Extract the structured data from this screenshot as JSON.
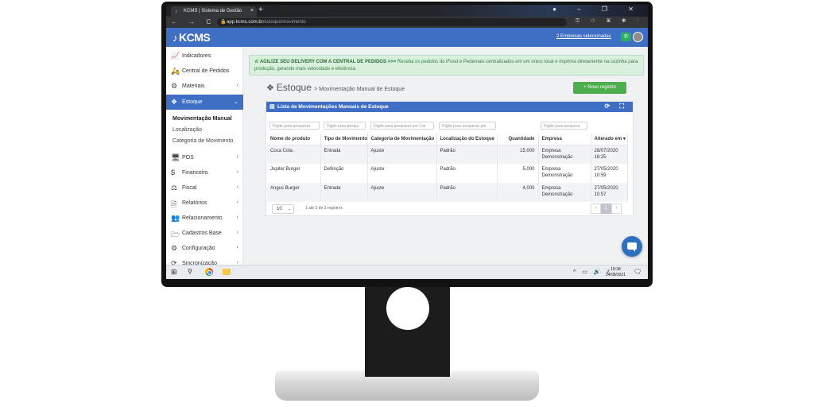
{
  "browser": {
    "tab_title": "KCMS | Sistema de Gestão",
    "tab_close": "×",
    "new_tab": "+",
    "window_controls": "● – ❐ ✕",
    "nav_icons": "← → C ⌂",
    "url_host": "app.kcms.com.br",
    "url_path": "/estoque/movimento",
    "extension_icons": "⚿ ☆ ▣ ✱ ⋮"
  },
  "header": {
    "logo": "KCMS",
    "companies_link": "2 Empresas selecionadas"
  },
  "sidebar": {
    "items": [
      {
        "label": "Indicadores",
        "icon": "chart-line-icon",
        "glyph": "📈",
        "chevron": ""
      },
      {
        "label": "Central de Pedidos",
        "icon": "motorcycle-icon",
        "glyph": "🛵",
        "chevron": ""
      },
      {
        "label": "Materiais",
        "icon": "cubes-icon",
        "glyph": "⚙",
        "chevron": "‹"
      },
      {
        "label": "Estoque",
        "icon": "boxes-icon",
        "glyph": "❖",
        "chevron": "⌄"
      },
      {
        "label": "POS",
        "icon": "desktop-icon",
        "glyph": "🖥",
        "chevron": "‹"
      },
      {
        "label": "Financeiro",
        "icon": "money-icon",
        "glyph": "$",
        "chevron": "‹"
      },
      {
        "label": "Fiscal",
        "icon": "balance-icon",
        "glyph": "⚖",
        "chevron": "‹"
      },
      {
        "label": "Relatórios",
        "icon": "file-icon",
        "glyph": "🗎",
        "chevron": "‹"
      },
      {
        "label": "Relacionamento",
        "icon": "users-icon",
        "glyph": "👥",
        "chevron": "‹"
      },
      {
        "label": "Cadastros Base",
        "icon": "folder-icon",
        "glyph": "🗁",
        "chevron": "‹"
      },
      {
        "label": "Configuração",
        "icon": "cogs-icon",
        "glyph": "⚙",
        "chevron": "‹"
      },
      {
        "label": "Sincronização",
        "icon": "sync-icon",
        "glyph": "⟳",
        "chevron": "‹"
      }
    ],
    "submenu": [
      "Movimentação Manual",
      "Localização",
      "Categoria de Movimento"
    ]
  },
  "banner": {
    "icon": "star-icon",
    "title": "☆ AGILIZE SEU DELIVERY COM A CENTRAL DE PEDIDOS >>>",
    "text": " Receba os pedidos do iFood e Pedemais centralizados em um único local e imprima diretamente na cozinha para produção, gerando mais velocidade e eficiência."
  },
  "page": {
    "title": "Estoque",
    "subtitle": "> Movimentação Manual de Estoque",
    "new_button": "+ Novo registro"
  },
  "card": {
    "title": "Lista de Movimentações Manuais de Estoque",
    "tools": "⟳ ⛶"
  },
  "filters": [
    "Digite para pesquisar",
    "Digite para pesqui",
    "Digite para pesquisar por Cat",
    "Digite para pesquisar por",
    "",
    "Digite para pesquisa"
  ],
  "table": {
    "columns": [
      "Nome do produto",
      "Tipo de Movimento",
      "Categoria de Movimentação",
      "Localização do Estoque",
      "Quantidade",
      "Empresa",
      "Alterado em ▾"
    ],
    "rows": [
      [
        "Coca Cola .",
        "Entrada",
        "Ajuste",
        "Padrão",
        "15,000",
        "Empresa Demonstração",
        "28/07/2020 16:25"
      ],
      [
        "Jupiter Burger",
        "Definição",
        "Ajuste",
        "Padrão",
        "5,000",
        "Empresa Demonstração",
        "27/05/2020 10:59"
      ],
      [
        "Angus Burger",
        "Entrada",
        "Ajuste",
        "Padrão",
        "4,000",
        "Empresa Demonstração",
        "27/05/2020 10:57"
      ]
    ]
  },
  "footer": {
    "page_size": "10",
    "records": "1 até 3 de 3 registros",
    "prev": "‹",
    "current_page": "1",
    "next": "›"
  },
  "taskbar": {
    "tray": "^ ▭ 🔊 ⫽",
    "time": "18:38",
    "date": "24/08/2021"
  },
  "colors": {
    "primary": "#3f6fc4",
    "success": "#4cae4c",
    "banner_bg": "#d9f0dd"
  }
}
